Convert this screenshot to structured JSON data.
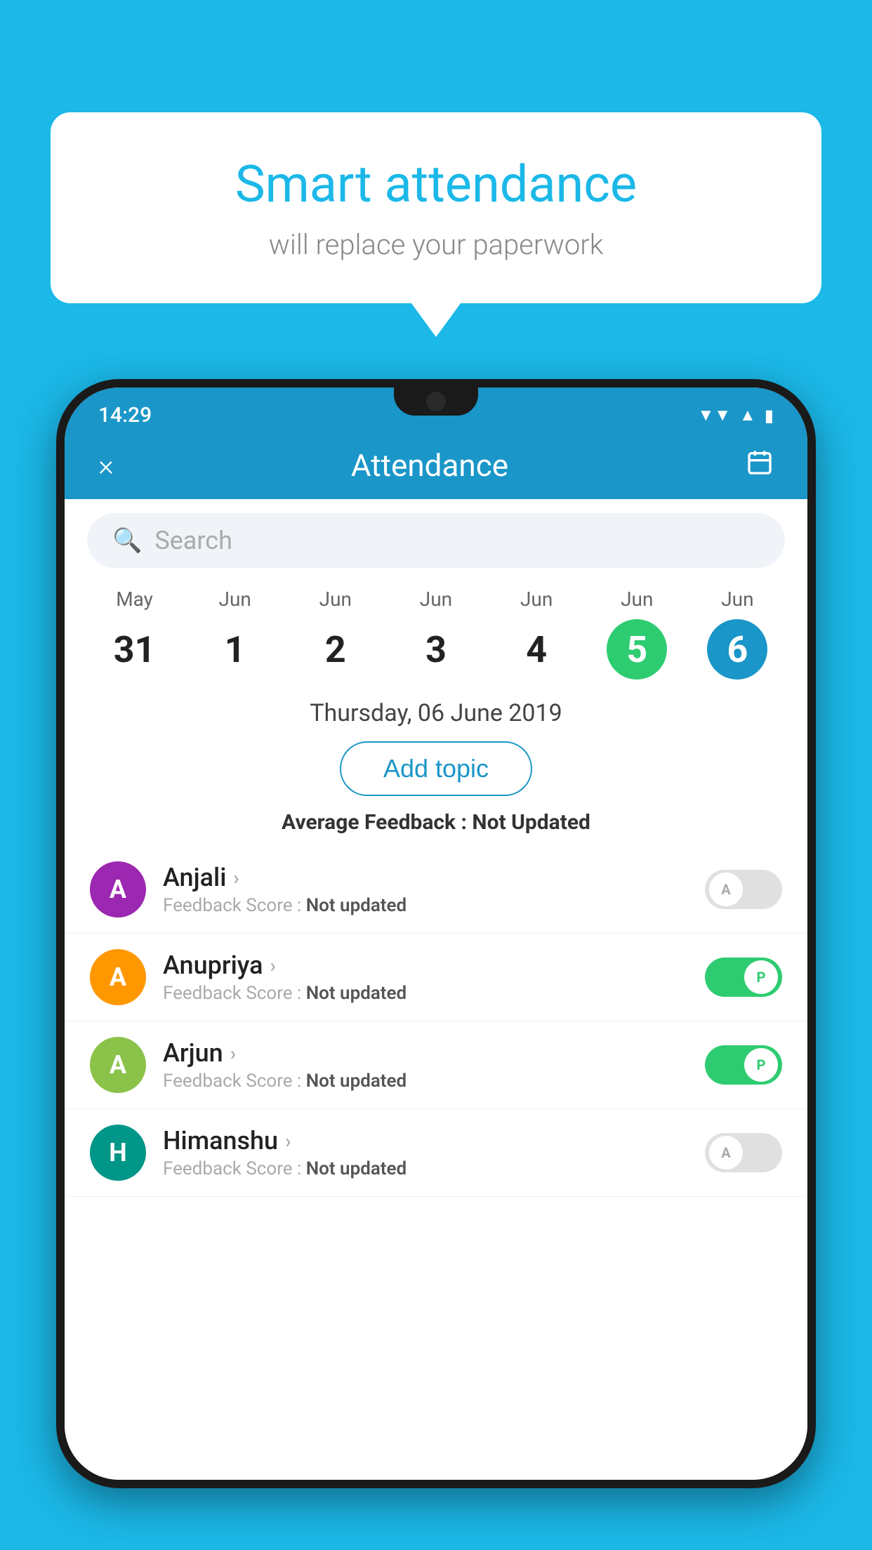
{
  "background_color": "#1bb8e8",
  "bubble": {
    "title": "Smart attendance",
    "subtitle": "will replace your paperwork"
  },
  "status_bar": {
    "time": "14:29",
    "icons": [
      "wifi",
      "signal",
      "battery"
    ]
  },
  "header": {
    "title": "Attendance",
    "close_label": "×",
    "calendar_icon": "📅"
  },
  "search": {
    "placeholder": "Search"
  },
  "calendar": {
    "days": [
      {
        "month": "May",
        "day": "31",
        "style": "normal"
      },
      {
        "month": "Jun",
        "day": "1",
        "style": "normal"
      },
      {
        "month": "Jun",
        "day": "2",
        "style": "normal"
      },
      {
        "month": "Jun",
        "day": "3",
        "style": "normal"
      },
      {
        "month": "Jun",
        "day": "4",
        "style": "normal"
      },
      {
        "month": "Jun",
        "day": "5",
        "style": "selected-green"
      },
      {
        "month": "Jun",
        "day": "6",
        "style": "selected-blue"
      }
    ],
    "selected_date": "Thursday, 06 June 2019"
  },
  "add_topic_label": "Add topic",
  "avg_feedback_label": "Average Feedback :",
  "avg_feedback_value": "Not Updated",
  "students": [
    {
      "name": "Anjali",
      "avatar_letter": "A",
      "avatar_color": "avatar-purple",
      "feedback_label": "Feedback Score :",
      "feedback_value": "Not updated",
      "attendance": "absent",
      "toggle_label": "A"
    },
    {
      "name": "Anupriya",
      "avatar_letter": "A",
      "avatar_color": "avatar-orange",
      "feedback_label": "Feedback Score :",
      "feedback_value": "Not updated",
      "attendance": "present",
      "toggle_label": "P"
    },
    {
      "name": "Arjun",
      "avatar_letter": "A",
      "avatar_color": "avatar-light-green",
      "feedback_label": "Feedback Score :",
      "feedback_value": "Not updated",
      "attendance": "present",
      "toggle_label": "P"
    },
    {
      "name": "Himanshu",
      "avatar_letter": "H",
      "avatar_color": "avatar-teal",
      "feedback_label": "Feedback Score :",
      "feedback_value": "Not updated",
      "attendance": "absent",
      "toggle_label": "A"
    }
  ]
}
